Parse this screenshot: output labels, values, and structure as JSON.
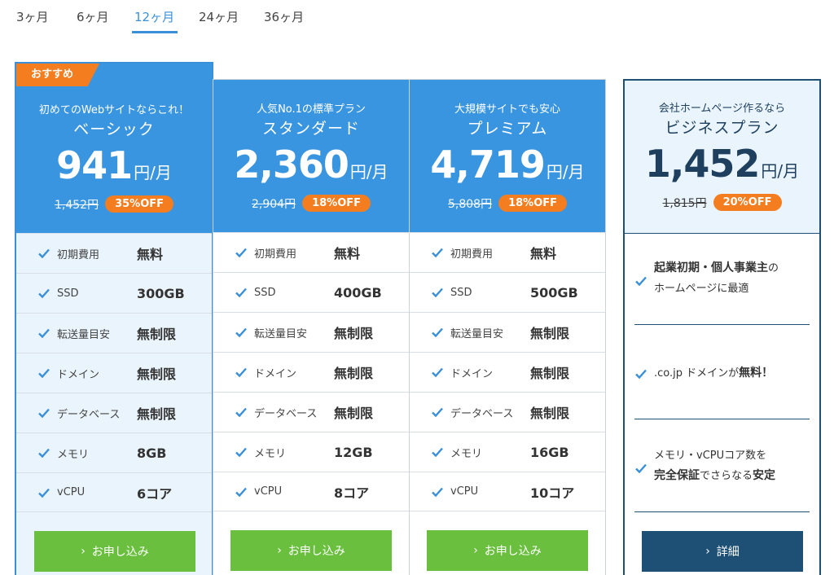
{
  "tabs": [
    {
      "label": "3ヶ月"
    },
    {
      "label": "6ヶ月"
    },
    {
      "label": "12ヶ月"
    },
    {
      "label": "24ヶ月"
    },
    {
      "label": "36ヶ月"
    }
  ],
  "badge": "おすすめ",
  "price_unit": "円/月",
  "plans": [
    {
      "subtitle": "初めてのWebサイトならこれ！",
      "name": "ベーシック",
      "price": "941",
      "old_price": "1,452円",
      "discount": "35%OFF",
      "features": [
        {
          "label": "初期費用",
          "value": "無料"
        },
        {
          "label": "SSD",
          "value": "300GB"
        },
        {
          "label": "転送量目安",
          "value": "無制限"
        },
        {
          "label": "ドメイン",
          "value": "無制限"
        },
        {
          "label": "データベース",
          "value": "無制限"
        },
        {
          "label": "メモリ",
          "value": "8GB"
        },
        {
          "label": "vCPU",
          "value": "6コア"
        }
      ],
      "button": "お申し込み"
    },
    {
      "subtitle": "人気No.1の標準プラン",
      "name": "スタンダード",
      "price": "2,360",
      "old_price": "2,904円",
      "discount": "18%OFF",
      "features": [
        {
          "label": "初期費用",
          "value": "無料"
        },
        {
          "label": "SSD",
          "value": "400GB"
        },
        {
          "label": "転送量目安",
          "value": "無制限"
        },
        {
          "label": "ドメイン",
          "value": "無制限"
        },
        {
          "label": "データベース",
          "value": "無制限"
        },
        {
          "label": "メモリ",
          "value": "12GB"
        },
        {
          "label": "vCPU",
          "value": "8コア"
        }
      ],
      "button": "お申し込み"
    },
    {
      "subtitle": "大規模サイトでも安心",
      "name": "プレミアム",
      "price": "4,719",
      "old_price": "5,808円",
      "discount": "18%OFF",
      "features": [
        {
          "label": "初期費用",
          "value": "無料"
        },
        {
          "label": "SSD",
          "value": "500GB"
        },
        {
          "label": "転送量目安",
          "value": "無制限"
        },
        {
          "label": "ドメイン",
          "value": "無制限"
        },
        {
          "label": "データベース",
          "value": "無制限"
        },
        {
          "label": "メモリ",
          "value": "16GB"
        },
        {
          "label": "vCPU",
          "value": "10コア"
        }
      ],
      "button": "お申し込み"
    }
  ],
  "business": {
    "subtitle": "会社ホームページ作るなら",
    "name": "ビジネスプラン",
    "price": "1,452",
    "old_price": "1,815円",
    "discount": "20%OFF",
    "items": [
      {
        "bold": "起業初期・個人事業主",
        "after": "の",
        "line2": "ホームページに最適"
      },
      {
        "before": ".co.jp ドメインが",
        "bold": "無料！"
      },
      {
        "line1": "メモリ・vCPUコア数を",
        "bold1": "完全保証",
        "mid": "でさらなる",
        "bold2": "安定"
      }
    ],
    "button": "詳細"
  },
  "colors": {
    "accent": "#3a95e0",
    "tab_active": "#3a8fd9",
    "discount": "#f47d20",
    "button": "#6abf3e",
    "button_dark": "#1e4f75"
  }
}
